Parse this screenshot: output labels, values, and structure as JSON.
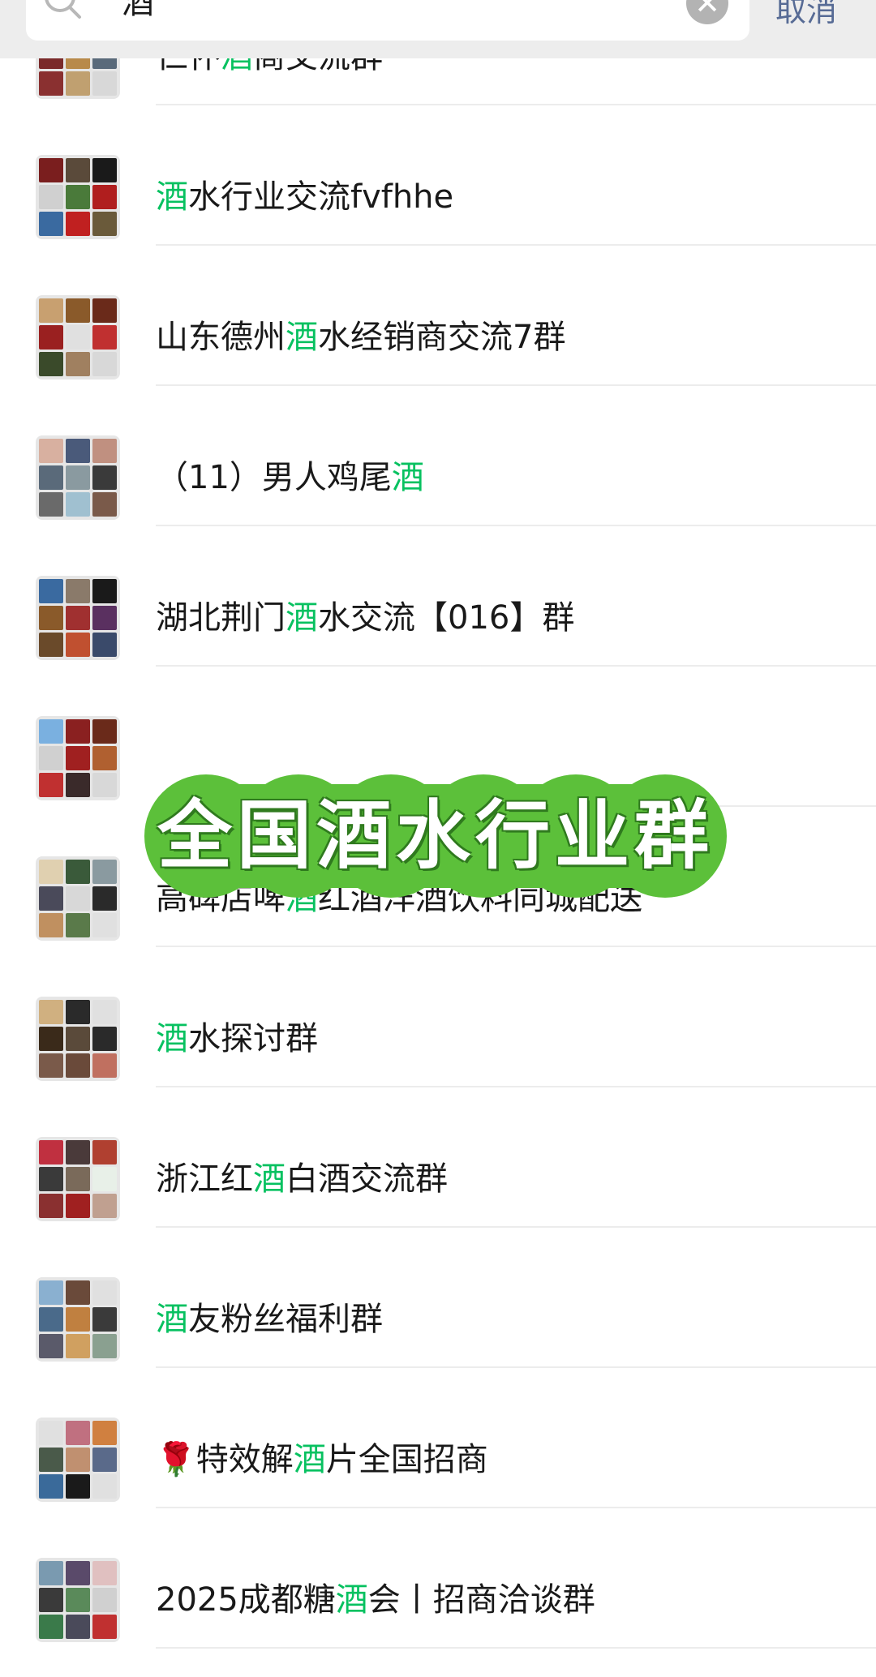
{
  "search": {
    "query": "酒",
    "cancel_label": "取消",
    "clear_icon": "✕"
  },
  "highlight_color": "#07c160",
  "results": [
    {
      "pre": "仁怀",
      "hl": "酒",
      "post": "商交流群",
      "avatar_colors": [
        "#3a5a80",
        "#7c8a6a",
        "#2f4d3d",
        "#7a2a2a",
        "#b88a4a",
        "#5a6a7a",
        "#8a3030",
        "#c0a070",
        "#d8d8d8"
      ]
    },
    {
      "pre": "",
      "hl": "酒",
      "post": "水行业交流fvfhhe",
      "avatar_colors": [
        "#7a1e1e",
        "#5a4a3a",
        "#1a1a1a",
        "#d0d0d0",
        "#4a7a3a",
        "#b01e1e",
        "#3a6aa0",
        "#c02020",
        "#6a5a3a"
      ]
    },
    {
      "pre": "山东德州",
      "hl": "酒",
      "post": "水经销商交流7群",
      "avatar_colors": [
        "#c8a070",
        "#8a5a2a",
        "#6a2a1a",
        "#9a2020",
        "#e0e0e0",
        "#c03030",
        "#3a4a2a",
        "#a08060",
        "#d8d8d8"
      ]
    },
    {
      "pre": "（11）男人鸡尾",
      "hl": "酒",
      "post": "",
      "avatar_colors": [
        "#d8b0a0",
        "#4a5a7a",
        "#c09080",
        "#5a6a7a",
        "#8a9aa0",
        "#3a3a3a",
        "#6a6a6a",
        "#a0c0d0",
        "#7a5a4a"
      ]
    },
    {
      "pre": "湖北荆门",
      "hl": "酒",
      "post": "水交流【016】群",
      "avatar_colors": [
        "#3a6aa0",
        "#8a7a6a",
        "#1a1a1a",
        "#8a5a2a",
        "#a03030",
        "#5a3060",
        "#6a4a2a",
        "#c05030",
        "#3a4a6a"
      ]
    },
    {
      "pre": "",
      "hl": "",
      "post": "",
      "avatar_colors": [
        "#7ab0e0",
        "#8a2020",
        "#6a2a1a",
        "#d0d0d0",
        "#a02020",
        "#b06030",
        "#c03030",
        "#3a2a2a",
        "#d8d8d8"
      ]
    },
    {
      "pre": "高碑店啤",
      "hl": "酒",
      "post": "红酒洋酒饮料同城配送",
      "avatar_colors": [
        "#e0d0b0",
        "#3a5a3a",
        "#8a9aa0",
        "#4a4a5a",
        "#d8d8d8",
        "#2a2a2a",
        "#c09060",
        "#5a7a4a",
        "#e0e0e0"
      ]
    },
    {
      "pre": "",
      "hl": "酒",
      "post": "水探讨群",
      "avatar_colors": [
        "#d0b080",
        "#2a2a2a",
        "#e0e0e0",
        "#3a2a1a",
        "#5a4a3a",
        "#2a2a2a",
        "#7a5a4a",
        "#6a4a3a",
        "#c07060"
      ]
    },
    {
      "pre": "浙江红",
      "hl": "酒",
      "post": "白酒交流群",
      "avatar_colors": [
        "#c03040",
        "#4a3a3a",
        "#b04030",
        "#3a3a3a",
        "#7a6a5a",
        "#e8f0e8",
        "#8a3030",
        "#a02020",
        "#c0a090"
      ]
    },
    {
      "pre": "",
      "hl": "酒",
      "post": "友粉丝福利群",
      "avatar_colors": [
        "#8ab0d0",
        "#6a4a3a",
        "#e0e0e0",
        "#4a6a8a",
        "#c08040",
        "#3a3a3a",
        "#5a5a6a",
        "#d0a060",
        "#8aa090"
      ]
    },
    {
      "pre": "🌹特效解",
      "hl": "酒",
      "post": "片全国招商",
      "avatar_colors": [
        "#e0e0e0",
        "#c07080",
        "#d08040",
        "#4a5a4a",
        "#c09070",
        "#5a6a8a",
        "#3a6a9a",
        "#1a1a1a",
        "#e0e0e0"
      ]
    },
    {
      "pre": "2025成都糖",
      "hl": "酒",
      "post": "会丨招商洽谈群",
      "avatar_colors": [
        "#7a9ab0",
        "#5a4a6a",
        "#e0c0c0",
        "#3a3a3a",
        "#5a8a5a",
        "#d0d0d0",
        "#3a7a4a",
        "#4a4a5a",
        "#c03030"
      ]
    }
  ],
  "banner": {
    "text": "全国酒水行业群",
    "color": "#5cc03a"
  }
}
